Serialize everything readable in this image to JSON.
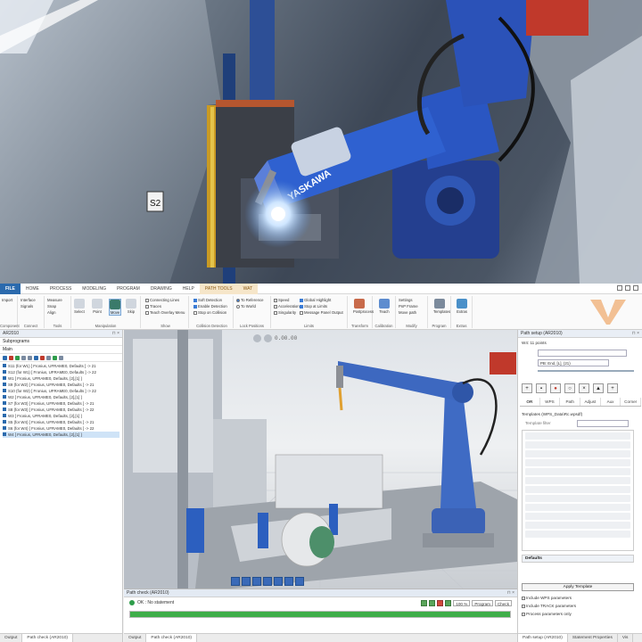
{
  "photo": {
    "robot_brand": "YASKAWA",
    "sign": "S2"
  },
  "ribbon_tabs": [
    "FILE",
    "HOME",
    "PROCESS",
    "MODELING",
    "PROGRAM",
    "DRAWING",
    "HELP",
    "PATH TOOLS",
    "WAT"
  ],
  "ribbon": {
    "groups": [
      {
        "label": "Component"
      },
      {
        "label": "Connect"
      },
      {
        "label": "Tools"
      },
      {
        "label": "Manipulation"
      },
      {
        "label": "Show"
      },
      {
        "label": "Collision Detection"
      },
      {
        "label": "Lock Positions"
      },
      {
        "label": "Limits"
      },
      {
        "label": "Transform"
      },
      {
        "label": "Calibration"
      },
      {
        "label": "Modify"
      },
      {
        "label": "Program"
      },
      {
        "label": "Extras"
      }
    ],
    "items": {
      "import": "Import",
      "interface": "Interface",
      "measure": "Measure",
      "signals": "Signals",
      "snap": "Snap",
      "align": "Align",
      "select": "Select",
      "move": "Move",
      "point": "Point",
      "skip": "Skip",
      "connecting_lines": "Connecting Lines",
      "traces": "Traces",
      "teach_overlay": "Teach Overlay Menu",
      "soft_detection": "Soft Detection",
      "enable_detection": "Enable Detection",
      "stop_on_collision": "Stop on Collision",
      "to_reference": "To Reference",
      "to_world": "To World",
      "speed": "Speed",
      "acceleration": "Acceleration",
      "singularity": "Singularity",
      "global_highlight": "Global Highlight",
      "stop_at_limits": "Stop at Limits",
      "message_panel": "Message Panel Output",
      "postprocess": "Postprocess",
      "teach": "Teach",
      "settings": "Settings",
      "pnp_frame": "PnP Frame",
      "move_path": "Move path",
      "templates": "Templates",
      "extras": "Extras"
    }
  },
  "left_panel": {
    "title": "AR2010",
    "subheader": "Subprograms",
    "main_label": "Main",
    "programs": [
      "S11 (for W1) [ Fronius, UFRAME0, Defaults ] -> 21",
      "S12 (for W1) [ Fronius, UFRAME0, Defaults ] -> 22",
      "W1 [ Fronius, UFRAME0, Defaults, [2],[1] ]",
      "S9 (for W2) [ Fronius, UFRAME0, Defaults ] -> 21",
      "S10 (for W2) [ Fronius, UFRAME0, Defaults ] -> 22",
      "W2 [ Fronius, UFRAME0, Defaults, [2],[1] ]",
      "S7 (for W3) [ Fronius, UFRAME0, Defaults ] -> 21",
      "S8 (for W3) [ Fronius, UFRAME0, Defaults ] -> 22",
      "W3 [ Fronius, UFRAME0, Defaults, [2],[1] ]",
      "S5 (for W4) [ Fronius, UFRAME0, Defaults ] -> 21",
      "S6 (for W4) [ Fronius, UFRAME0, Defaults ] -> 22",
      "W4 [ Fronius, UFRAME0, Defaults, [2],[1] ]"
    ],
    "selected_index": 11,
    "bottom_tabs": [
      "Output",
      "Path check (AR2010)"
    ]
  },
  "viewport": {
    "time": "0.00.00"
  },
  "check_panel": {
    "title": "Path check (AR2010)",
    "status": "OK : No statement",
    "progress": 100,
    "zoom": "100 %",
    "mode": "Program",
    "check_label": "Check"
  },
  "bottom_tabs": [
    "Output",
    "Path check (AR2010)"
  ],
  "right_panel": {
    "title": "Path setup (AR2010)",
    "path_label": "W4: 11 points",
    "point_field": "PB: End, [L], (21)",
    "tabs": [
      "OR",
      "WPS",
      "Path",
      "Adjust",
      "Aux",
      "Corner"
    ],
    "templates_label": "Templates (WPS_Data\\Rc.wpsdf)",
    "template_filter": "Template filter",
    "defaults": "Defaults",
    "apply_button": "Apply Template",
    "options": [
      "Include WPS parameters",
      "Include TRACK parameters",
      "Process parameters only"
    ],
    "bottom_tabs": [
      "Path setup (AR2010)",
      "Statement Properties",
      "Vis"
    ]
  }
}
